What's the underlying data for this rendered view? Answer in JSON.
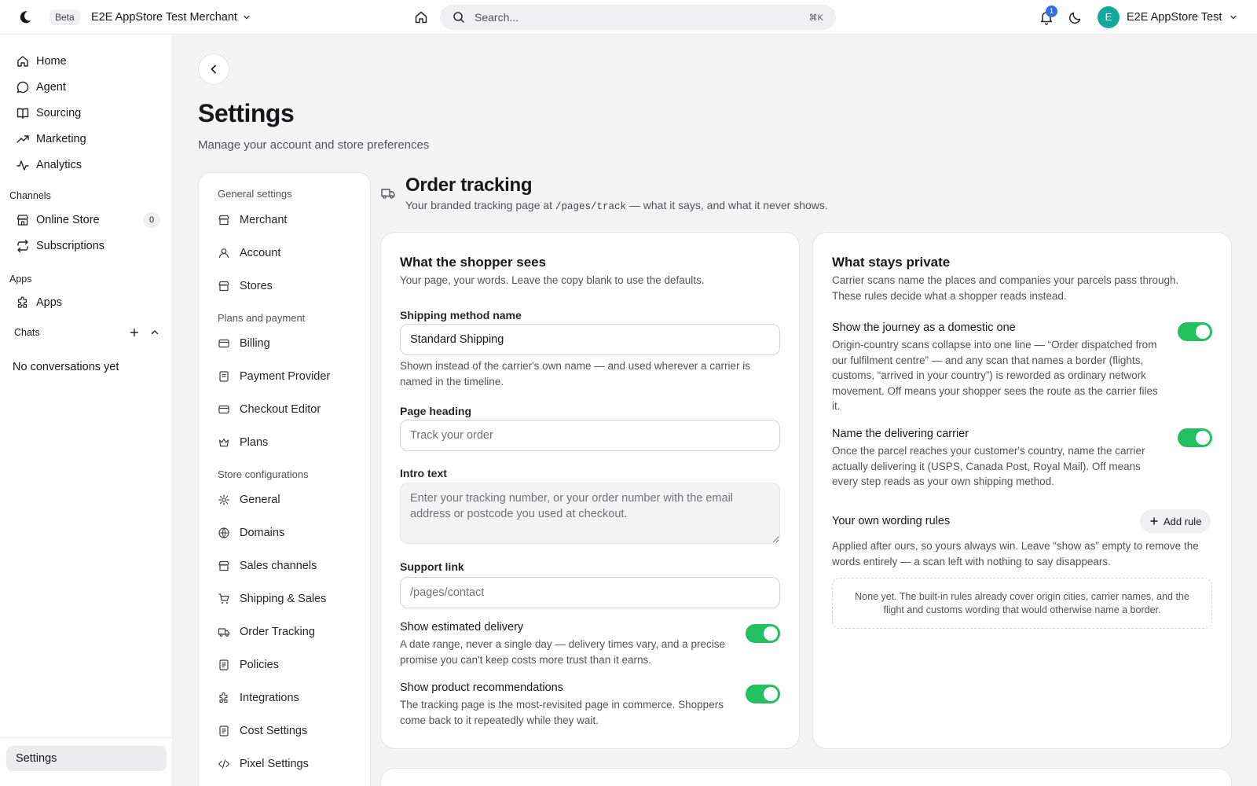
{
  "topbar": {
    "beta": "Beta",
    "merchant_name": "E2E AppStore Test Merchant",
    "search_placeholder": "Search...",
    "search_shortcut": "⌘K",
    "notification_count": "1",
    "avatar_letter": "E",
    "user_name": "E2E AppStore Test"
  },
  "sidebar": {
    "main": [
      "Home",
      "Agent",
      "Sourcing",
      "Marketing",
      "Analytics"
    ],
    "channels_label": "Channels",
    "channels": [
      {
        "label": "Online Store",
        "count": "0"
      },
      {
        "label": "Subscriptions"
      }
    ],
    "apps_label": "Apps",
    "apps": [
      "Apps"
    ],
    "chats_label": "Chats",
    "no_conversations": "No conversations yet",
    "settings": "Settings"
  },
  "page": {
    "title": "Settings",
    "subtitle": "Manage your account and store preferences"
  },
  "settings_nav": {
    "groups": [
      {
        "label": "General settings",
        "items": [
          "Merchant",
          "Account",
          "Stores"
        ]
      },
      {
        "label": "Plans and payment",
        "items": [
          "Billing",
          "Payment Provider",
          "Checkout Editor",
          "Plans"
        ]
      },
      {
        "label": "Store configurations",
        "items": [
          "General",
          "Domains",
          "Sales channels",
          "Shipping & Sales",
          "Order Tracking",
          "Policies",
          "Integrations",
          "Cost Settings",
          "Pixel Settings"
        ]
      }
    ]
  },
  "section": {
    "title": "Order tracking",
    "sub_before": "Your branded tracking page at",
    "sub_code": "/pages/track",
    "sub_after": "— what it says, and what it never shows."
  },
  "shopper": {
    "title": "What the shopper sees",
    "subtitle": "Your page, your words. Leave the copy blank to use the defaults.",
    "shipping_label": "Shipping method name",
    "shipping_value": "Standard Shipping",
    "shipping_help": "Shown instead of the carrier's own name — and used wherever a carrier is named in the timeline.",
    "heading_label": "Page heading",
    "heading_placeholder": "Track your order",
    "intro_label": "Intro text",
    "intro_placeholder": "Enter your tracking number, or your order number with the email address or postcode you used at checkout.",
    "support_label": "Support link",
    "support_placeholder": "/pages/contact",
    "est_title": "Show estimated delivery",
    "est_desc": "A date range, never a single day — delivery times vary, and a precise promise you can't keep costs more trust than it earns.",
    "est_on": true,
    "rec_title": "Show product recommendations",
    "rec_desc": "The tracking page is the most-revisited page in commerce. Shoppers come back to it repeatedly while they wait.",
    "rec_on": true
  },
  "private": {
    "title": "What stays private",
    "subtitle": "Carrier scans name the places and companies your parcels pass through. These rules decide what a shopper reads instead.",
    "domestic_title": "Show the journey as a domestic one",
    "domestic_desc": "Origin-country scans collapse into one line — “Order dispatched from our fulfilment centre” — and any scan that names a border (flights, customs, “arrived in your country”) is reworded as ordinary network movement. Off means your shopper sees the route as the carrier files it.",
    "domestic_on": true,
    "carrier_title": "Name the delivering carrier",
    "carrier_desc": "Once the parcel reaches your customer's country, name the carrier actually delivering it (USPS, Canada Post, Royal Mail). Off means every step reads as your own shipping method.",
    "carrier_on": true,
    "rules_title": "Your own wording rules",
    "add_rule": "Add rule",
    "rules_desc": "Applied after ours, so yours always win. Leave “show as” empty to remove the words entirely — a scan left with nothing to say disappears.",
    "empty": "None yet. The built-in rules already cover origin cities, carrier names, and the flight and customs wording that would otherwise name a border."
  },
  "colors": {
    "accent_toggle": "#22c05e",
    "badge": "#2f6fed",
    "avatar": "#14a99a"
  }
}
